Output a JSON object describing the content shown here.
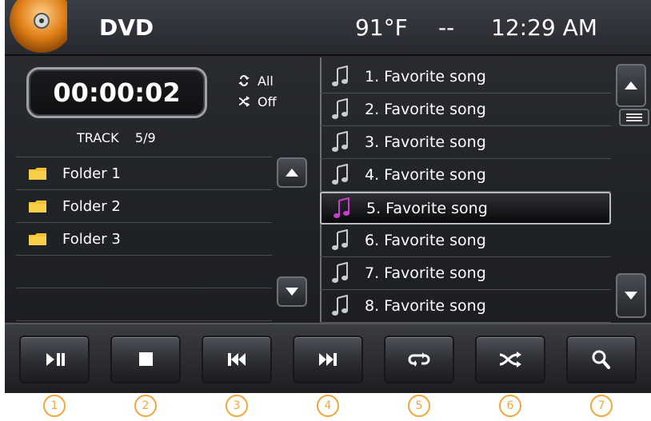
{
  "header": {
    "title": "DVD",
    "temperature": "91°F",
    "separator": "--",
    "time": "12:29 AM"
  },
  "player": {
    "elapsed": "00:00:02",
    "repeat_label": "All",
    "shuffle_label": "Off",
    "track_label": "TRACK",
    "track_value": "5/9"
  },
  "folders": [
    {
      "label": "Folder 1"
    },
    {
      "label": "Folder 2"
    },
    {
      "label": "Folder 3"
    },
    {
      "label": ""
    },
    {
      "label": ""
    }
  ],
  "songs": [
    {
      "label": "1. Favorite song",
      "active": false
    },
    {
      "label": "2. Favorite song",
      "active": false
    },
    {
      "label": "3. Favorite song",
      "active": false
    },
    {
      "label": "4. Favorite song",
      "active": false
    },
    {
      "label": "5. Favorite song",
      "active": true
    },
    {
      "label": "6. Favorite song",
      "active": false
    },
    {
      "label": "7. Favorite song",
      "active": false
    },
    {
      "label": "8. Favorite song",
      "active": false
    }
  ],
  "controls": [
    {
      "icon": "play-pause-icon",
      "callout": "1"
    },
    {
      "icon": "stop-icon",
      "callout": "2"
    },
    {
      "icon": "previous-icon",
      "callout": "3"
    },
    {
      "icon": "next-icon",
      "callout": "4"
    },
    {
      "icon": "repeat-icon",
      "callout": "5"
    },
    {
      "icon": "shuffle-icon",
      "callout": "6"
    },
    {
      "icon": "search-icon",
      "callout": "7"
    }
  ],
  "colors": {
    "accent_orange": "#f0a73a",
    "active_note": "#c63fc8",
    "folder_yellow": "#f2c230"
  }
}
